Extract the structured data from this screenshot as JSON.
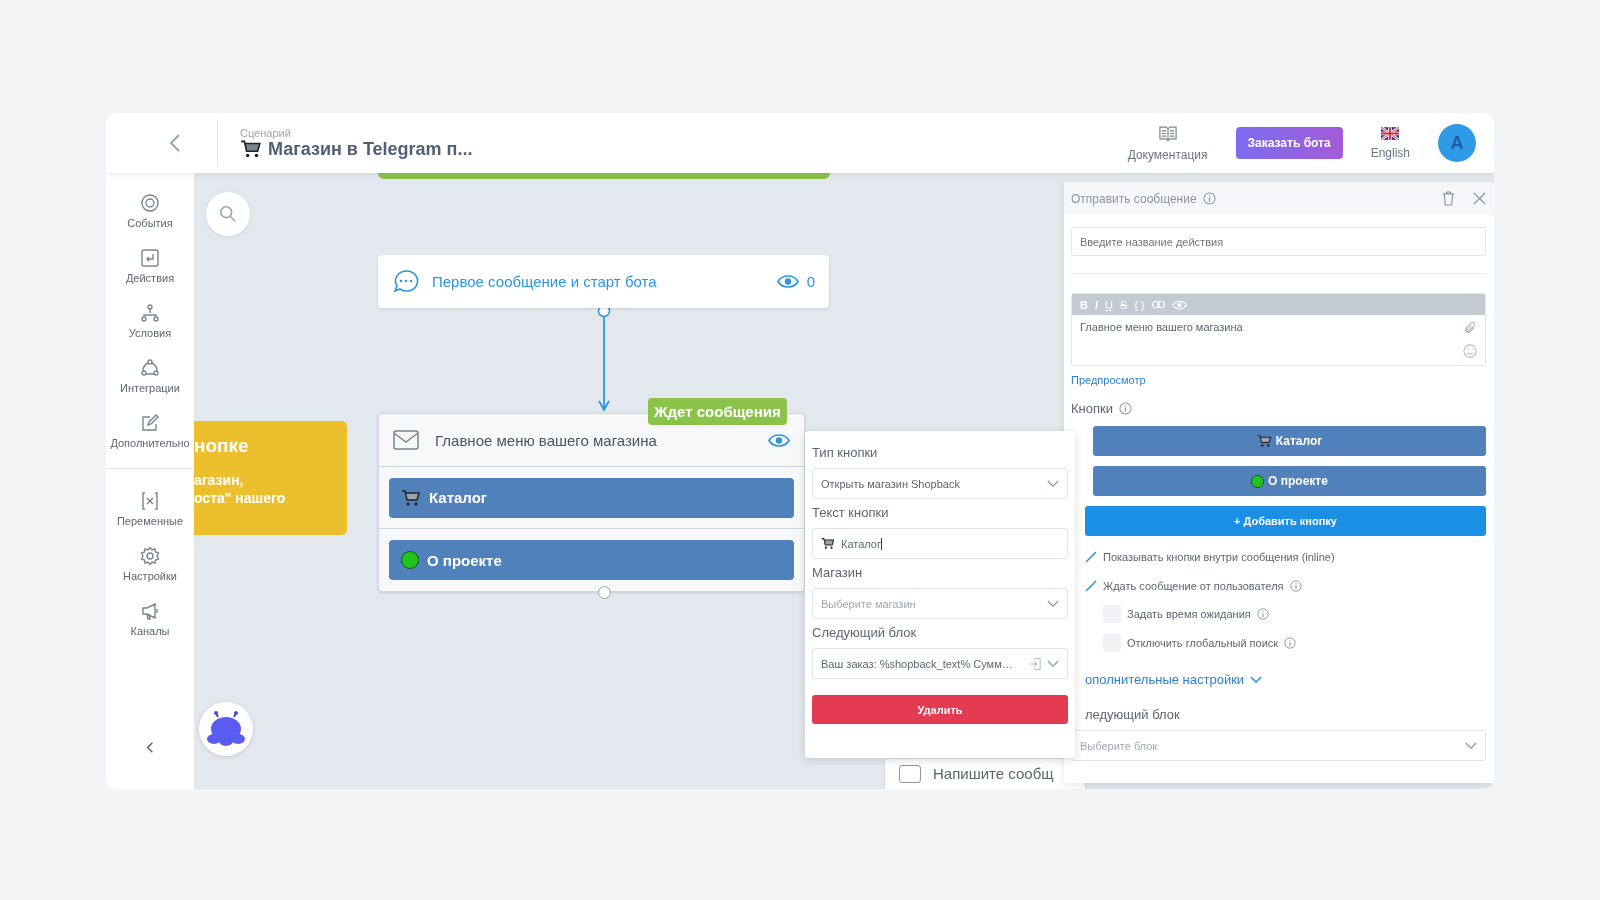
{
  "header": {
    "breadcrumb": "Сценарий",
    "title": "Магазин в Telegram п...",
    "docs": "Документация",
    "order_button": "Заказать бота",
    "language": "English",
    "avatar": "А"
  },
  "sidebar": {
    "groups": [
      {
        "items": [
          {
            "kind": "target",
            "label": "События"
          },
          {
            "kind": "return",
            "label": "Действия"
          },
          {
            "kind": "branches",
            "label": "Условия"
          },
          {
            "kind": "integrations",
            "label": "Интеграции"
          },
          {
            "kind": "edit",
            "label": "Дополнительно"
          }
        ]
      },
      {
        "items": [
          {
            "kind": "variable",
            "label": "Переменные"
          },
          {
            "kind": "gear",
            "label": "Настройки"
          },
          {
            "kind": "megaphone",
            "label": "Каналы"
          }
        ]
      }
    ]
  },
  "canvas": {
    "note_card": {
      "title": "нопке",
      "lines": [
        "агазин,",
        "оста\" нашего"
      ]
    },
    "nodes": [
      {
        "kind": "start",
        "title": "Первое сообщение и старт бота",
        "views": "0"
      },
      {
        "kind": "message",
        "title": "Главное меню вашего магазина",
        "badge": "Ждет сообщения",
        "buttons": [
          {
            "kind": "cart",
            "label": "Каталог"
          },
          {
            "kind": "dot",
            "label": "О проекте"
          }
        ]
      },
      {
        "kind": "partial",
        "title": "Напишите сообщ"
      }
    ]
  },
  "popup": {
    "fields": [
      {
        "kind": "select",
        "label": "Тип кнопки",
        "value": "Открыть магазин Shopback"
      },
      {
        "kind": "input",
        "label": "Текст кнопки",
        "value": "Каталог"
      },
      {
        "kind": "select",
        "label": "Магазин",
        "placeholder": "Выберите магазин"
      },
      {
        "kind": "select",
        "label": "Следующий блок",
        "value": "Ваш заказ: %shopback_text% Сумм…",
        "link": true
      }
    ],
    "delete_button": "Удалить"
  },
  "panel": {
    "title": "Отправить сообщение",
    "name_placeholder": "Введите название действия",
    "toolbar": [
      "B",
      "I",
      "U",
      "S",
      "{ }"
    ],
    "message": "Главное меню вашего магазина",
    "preview_link": "Предпросмотр",
    "buttons_label": "Кнопки",
    "buttons": [
      {
        "kind": "cart",
        "label": "Каталог"
      },
      {
        "kind": "dot",
        "label": "О проекте"
      }
    ],
    "add_button": "+ Добавить кнопку",
    "options": [
      {
        "label": "Показывать кнопки внутри сообщения (inline)",
        "checked": true,
        "info": false
      },
      {
        "label": "Ждать сообщение от пользователя",
        "checked": true,
        "info": true,
        "children": [
          {
            "label": "Задать время ожидания",
            "checked": false,
            "info": true
          },
          {
            "label": "Отключить глобальный поиск",
            "checked": false,
            "info": true
          }
        ]
      }
    ],
    "advanced_link": "ополнительные настройки",
    "next_label": "ледующий блок",
    "next_placeholder": "Выберите блок"
  }
}
